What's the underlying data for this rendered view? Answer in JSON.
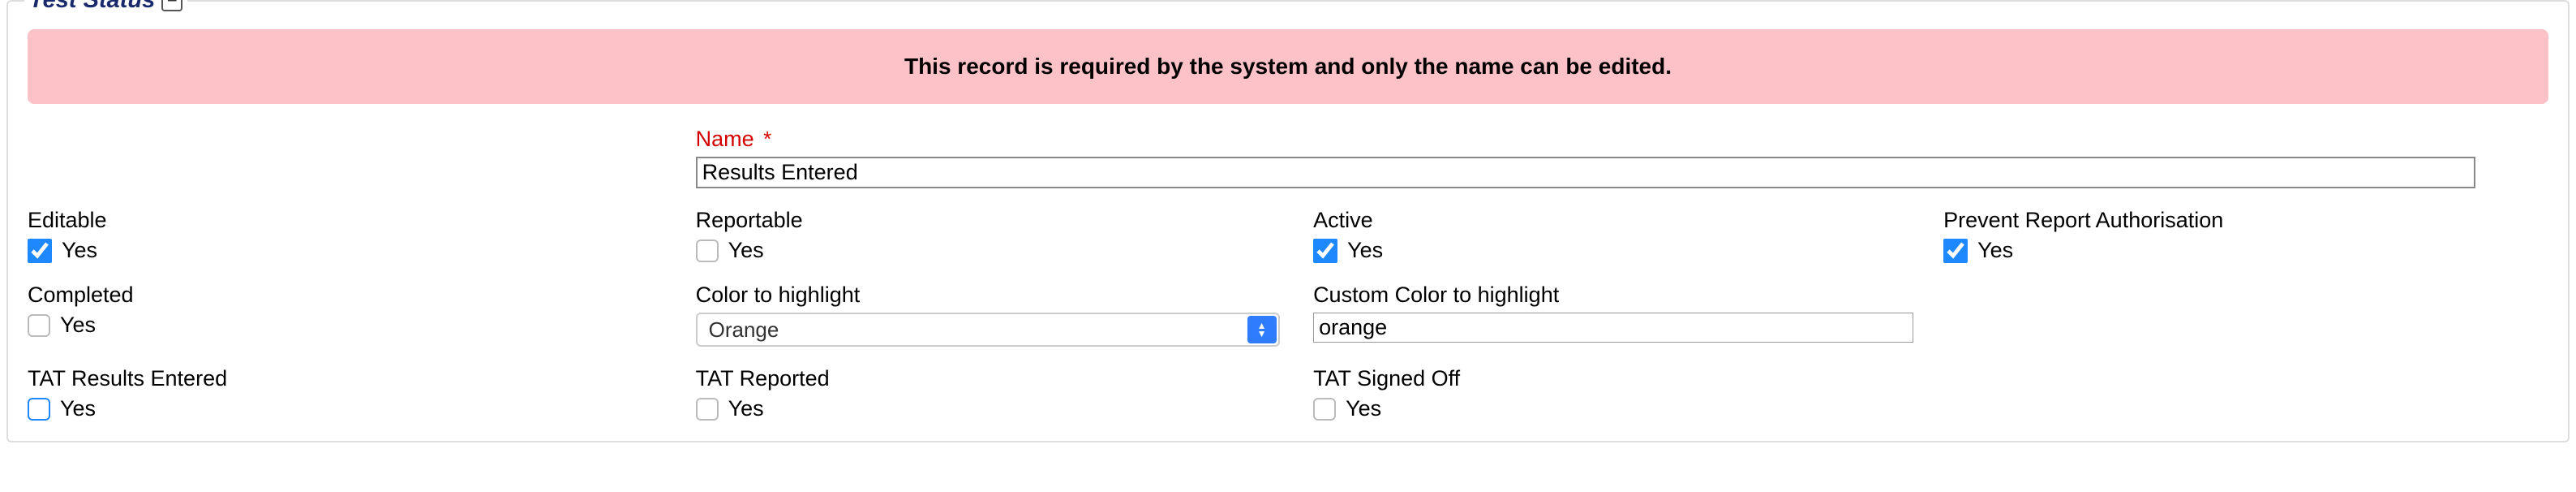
{
  "fieldset": {
    "title": "Test Status",
    "collapse_glyph": "−"
  },
  "alert": {
    "message": "This record is required by the system and only the name can be edited."
  },
  "name": {
    "label": "Name",
    "required_mark": "*",
    "value": "Results Entered"
  },
  "row1": {
    "editable": {
      "label": "Editable",
      "value_label": "Yes",
      "checked": true
    },
    "reportable": {
      "label": "Reportable",
      "value_label": "Yes",
      "checked": false
    },
    "active": {
      "label": "Active",
      "value_label": "Yes",
      "checked": true
    },
    "prevent": {
      "label": "Prevent Report Authorisation",
      "value_label": "Yes",
      "checked": true
    }
  },
  "row2": {
    "completed": {
      "label": "Completed",
      "value_label": "Yes",
      "checked": false
    },
    "color": {
      "label": "Color to highlight",
      "selected": "Orange"
    },
    "custom_color": {
      "label": "Custom Color to highlight",
      "value": "orange"
    }
  },
  "row3": {
    "tat_results": {
      "label": "TAT Results Entered",
      "value_label": "Yes",
      "checked": false
    },
    "tat_reported": {
      "label": "TAT Reported",
      "value_label": "Yes",
      "checked": false
    },
    "tat_signed": {
      "label": "TAT Signed Off",
      "value_label": "Yes",
      "checked": false
    }
  }
}
